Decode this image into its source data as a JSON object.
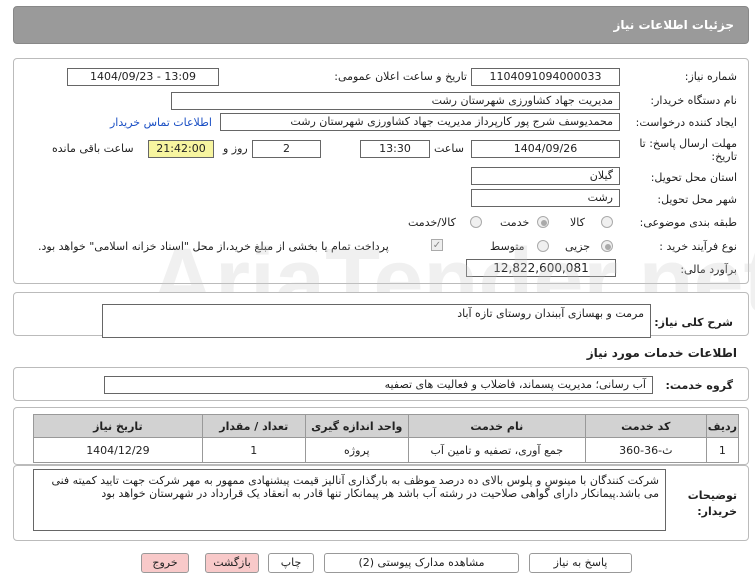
{
  "header": {
    "title": "جزئیات اطلاعات نیاز"
  },
  "form": {
    "need_number_label": "شماره نیاز:",
    "need_number": "1104091094000033",
    "announce_label": "تاریخ و ساعت اعلان عمومی:",
    "announce_value": "1404/09/23 - 13:09",
    "buyer_org_label": "نام دستگاه خریدار:",
    "buyer_org": "مدیریت جهاد کشاورزی شهرستان رشت",
    "requester_label": "ایجاد کننده درخواست:",
    "requester": "محمدیوسف شرج پور کارپرداز مدیریت جهاد کشاورزی شهرستان رشت",
    "contact_link": "اطلاعات تماس خریدار",
    "deadline_label": "مهلت ارسال پاسخ: تا تاریخ:",
    "deadline_date": "1404/09/26",
    "time_label": "ساعت",
    "deadline_time": "13:30",
    "days_value": "2",
    "days_label": "روز و",
    "remaining_time": "21:42:00",
    "remaining_label": "ساعت باقی مانده",
    "province_label": "استان محل تحویل:",
    "province": "گیلان",
    "city_label": "شهر محل تحویل:",
    "city": "رشت",
    "category_label": "طبقه بندی موضوعی:",
    "category_options": [
      "کالا",
      "خدمت",
      "کالا/خدمت"
    ],
    "category_selected": "خدمت",
    "process_label": "نوع فرآیند خرید :",
    "process_options": [
      "جزیی",
      "متوسط"
    ],
    "process_selected": "جزیی",
    "payment_note": "پرداخت تمام یا بخشی از مبلغ خرید،از محل \"اسناد خزانه اسلامی\" خواهد بود.",
    "estimate_label": "برآورد مالی:",
    "estimate": "12,822,600,081"
  },
  "description": {
    "label": "شرح کلی نیاز:",
    "text": "مرمت و بهسازی آببندان روستای تازه آباد"
  },
  "services": {
    "section_title": "اطلاعات خدمات مورد نیاز",
    "group_label": "گروه خدمت:",
    "group_value": "آب رسانی؛ مدیریت پسماند، فاضلاب و فعالیت های تصفیه",
    "columns": [
      "ردیف",
      "کد خدمت",
      "نام خدمت",
      "واحد اندازه گیری",
      "تعداد / مقدار",
      "تاریخ نیاز"
    ],
    "rows": [
      [
        "1",
        "ث-36-360",
        "جمع آوری، تصفیه و تامین آب",
        "پروژه",
        "1",
        "1404/12/29"
      ]
    ]
  },
  "buyer_notes": {
    "label": "توضیحات خریدار:",
    "text": "شرکت کنندگان با مینوس و پلوس بالای ده درصد موظف به بارگذاری آنالیز قیمت پیشنهادی ممهور به مهر شرکت جهت تایید کمیته فنی می باشد.پیمانکار دارای گواهی صلاحیت در رشته  آب باشد هر پیمانکار تنها قادر به انعقاد یک قرارداد در شهرستان خواهد بود"
  },
  "buttons": {
    "reply": "پاسخ به نیاز",
    "view_docs": "مشاهده مدارک پیوستی (2)",
    "print": "چاپ",
    "back": "بازگشت",
    "exit": "خروج"
  },
  "watermark": "AriaTender.net",
  "colors": {
    "header_bg": "#9a9a9a",
    "yellow": "#f7f5a0",
    "link": "#1a4fc4",
    "pink_button": "#f8c9c9"
  }
}
